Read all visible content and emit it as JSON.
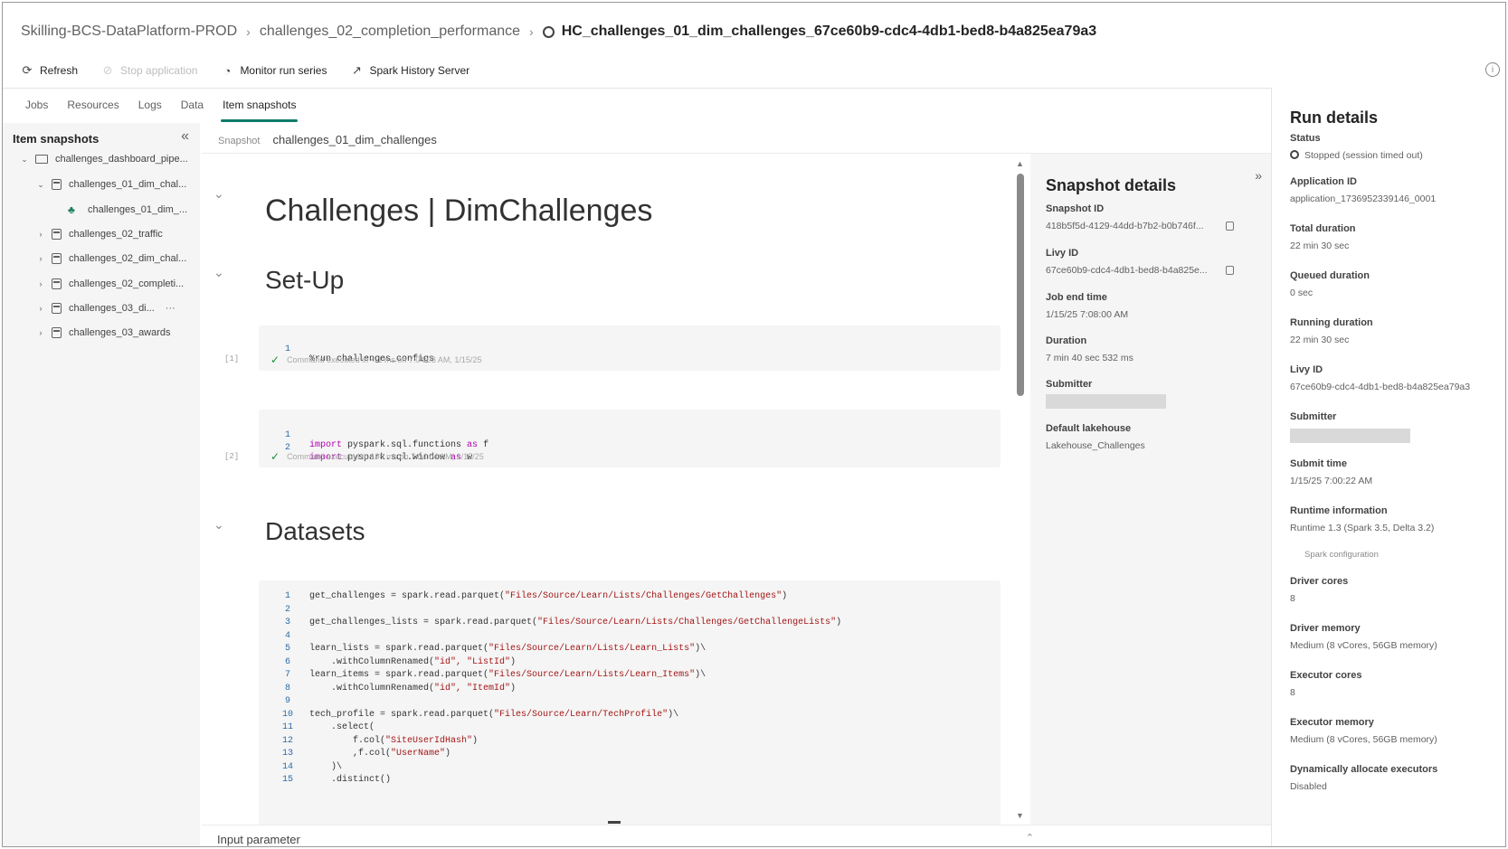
{
  "breadcrumb": {
    "workspace": "Skilling-BCS-DataPlatform-PROD",
    "notebook": "challenges_02_completion_performance",
    "current": "HC_challenges_01_dim_challenges_67ce60b9-cdc4-4db1-bed8-b4a825ea79a3"
  },
  "toolbar": {
    "refresh": "Refresh",
    "stop": "Stop application",
    "monitor": "Monitor run series",
    "spark_history": "Spark History Server"
  },
  "tabs": [
    "Jobs",
    "Resources",
    "Logs",
    "Data",
    "Item snapshots"
  ],
  "active_tab": "Item snapshots",
  "left_panel": {
    "title": "Item snapshots",
    "tree": [
      {
        "label": "challenges_dashboard_pipe...",
        "type": "pipeline"
      },
      {
        "label": "challenges_01_dim_chal...",
        "type": "notebook"
      },
      {
        "label": "challenges_01_dim_...",
        "type": "snapshot"
      },
      {
        "label": "challenges_02_traffic",
        "type": "notebook"
      },
      {
        "label": "challenges_02_dim_chal...",
        "type": "notebook"
      },
      {
        "label": "challenges_02_completi...",
        "type": "notebook"
      },
      {
        "label": "challenges_03_di...",
        "type": "notebook"
      },
      {
        "label": "challenges_03_awards",
        "type": "notebook"
      }
    ]
  },
  "snapshot_row": {
    "label": "Snapshot",
    "value": "challenges_01_dim_challenges"
  },
  "notebook": {
    "title": "Challenges | DimChallenges",
    "section_setup": "Set-Up",
    "section_datasets": "Datasets",
    "cell1": {
      "exec_count": "[1]",
      "status": "Command executed in < 1 ms on 7:04:03 AM, 1/15/25",
      "lines": [
        {
          "n": "1",
          "code": "%run challenges_configs"
        }
      ]
    },
    "cell2": {
      "exec_count": "[2]",
      "status": "Command executed in 198 ms on 7:04:04 AM, 1/15/25",
      "lines": [
        {
          "n": "1",
          "kw": "import",
          "mid": " pyspark.sql.functions ",
          "kw2": "as",
          "end": " f"
        },
        {
          "n": "2",
          "kw": "import",
          "mid": " pyspark.sql.window ",
          "kw2": "as",
          "end": " w"
        }
      ]
    },
    "cell3": {
      "lines": [
        {
          "n": "1",
          "pre": "get_challenges = spark.read.parquet(",
          "str": "\"Files/Source/Learn/Lists/Challenges/GetChallenges\"",
          "post": ")"
        },
        {
          "n": "2",
          "pre": "",
          "str": "",
          "post": ""
        },
        {
          "n": "3",
          "pre": "get_challenges_lists = spark.read.parquet(",
          "str": "\"Files/Source/Learn/Lists/Challenges/GetChallengeLists\"",
          "post": ")"
        },
        {
          "n": "4",
          "pre": "",
          "str": "",
          "post": ""
        },
        {
          "n": "5",
          "pre": "learn_lists = spark.read.parquet(",
          "str": "\"Files/Source/Learn/Lists/Learn_Lists\"",
          "post": ")\\"
        },
        {
          "n": "6",
          "pre": "    .withColumnRenamed(",
          "str": "\"id\", \"ListId\"",
          "post": ")"
        },
        {
          "n": "7",
          "pre": "learn_items = spark.read.parquet(",
          "str": "\"Files/Source/Learn/Lists/Learn_Items\"",
          "post": ")\\"
        },
        {
          "n": "8",
          "pre": "    .withColumnRenamed(",
          "str": "\"id\", \"ItemId\"",
          "post": ")"
        },
        {
          "n": "9",
          "pre": "",
          "str": "",
          "post": ""
        },
        {
          "n": "10",
          "pre": "tech_profile = spark.read.parquet(",
          "str": "\"Files/Source/Learn/TechProfile\"",
          "post": ")\\"
        },
        {
          "n": "11",
          "pre": "    .select(",
          "str": "",
          "post": ""
        },
        {
          "n": "12",
          "pre": "        f.col(",
          "str": "\"SiteUserIdHash\"",
          "post": ")"
        },
        {
          "n": "13",
          "pre": "        ,f.col(",
          "str": "\"UserName\"",
          "post": ")"
        },
        {
          "n": "14",
          "pre": "    )\\",
          "str": "",
          "post": ""
        },
        {
          "n": "15",
          "pre": "    .distinct()",
          "str": "",
          "post": ""
        }
      ]
    }
  },
  "snapshot_details": {
    "title": "Snapshot details",
    "fields": [
      {
        "label": "Snapshot ID",
        "value": "418b5f5d-4129-44dd-b7b2-b0b746f...",
        "copy": true
      },
      {
        "label": "Livy ID",
        "value": "67ce60b9-cdc4-4db1-bed8-b4a825e...",
        "copy": true
      },
      {
        "label": "Job end time",
        "value": "1/15/25 7:08:00 AM"
      },
      {
        "label": "Duration",
        "value": "7 min 40 sec 532 ms"
      },
      {
        "label": "Submitter",
        "value": ""
      },
      {
        "label": "Default lakehouse",
        "value": "Lakehouse_Challenges"
      }
    ]
  },
  "run_details": {
    "title": "Run details",
    "fields": [
      {
        "label": "Status",
        "value": "Stopped (session timed out)"
      },
      {
        "label": "Application ID",
        "value": "application_1736952339146_0001"
      },
      {
        "label": "Total duration",
        "value": "22 min 30 sec"
      },
      {
        "label": "Queued duration",
        "value": "0 sec"
      },
      {
        "label": "Running duration",
        "value": "22 min 30 sec"
      },
      {
        "label": "Livy ID",
        "value": "67ce60b9-cdc4-4db1-bed8-b4a825ea79a3"
      },
      {
        "label": "Submitter",
        "value": ""
      },
      {
        "label": "Submit time",
        "value": "1/15/25 7:00:22 AM"
      },
      {
        "label": "Runtime information",
        "value": "Runtime 1.3 (Spark 3.5, Delta 3.2)"
      },
      {
        "label": "Driver cores",
        "value": "8"
      },
      {
        "label": "Driver memory",
        "value": "Medium (8 vCores, 56GB memory)"
      },
      {
        "label": "Executor cores",
        "value": "8"
      },
      {
        "label": "Executor memory",
        "value": "Medium (8 vCores, 56GB memory)"
      },
      {
        "label": "Dynamically allocate executors",
        "value": "Disabled"
      }
    ],
    "spark_config_link": "Spark configuration"
  },
  "bottom": {
    "input_parameter": "Input parameter"
  },
  "colors": {
    "accent": "#0e7a6a",
    "selection": "#0f6cbd",
    "panel_bg": "#f5f5f5",
    "string": "#a31515",
    "keyword": "#b000b0"
  }
}
